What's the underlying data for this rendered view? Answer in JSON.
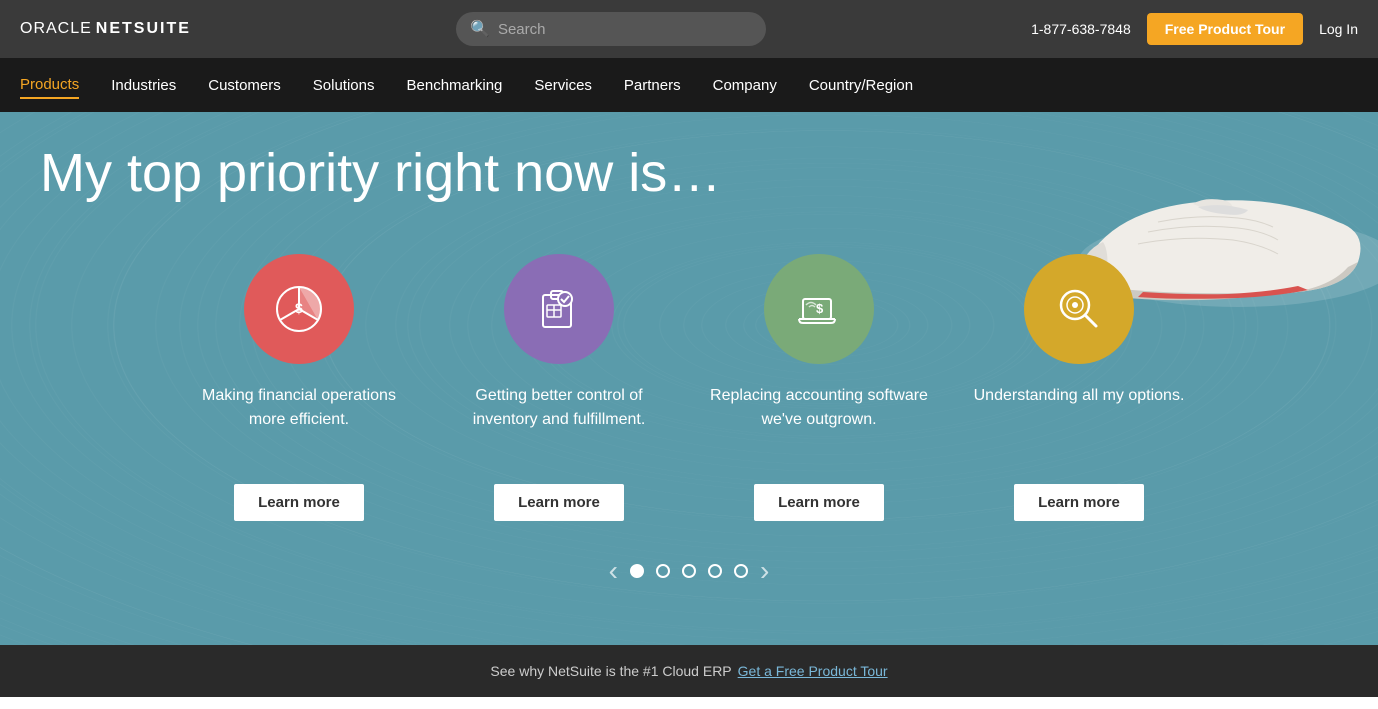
{
  "topbar": {
    "logo_oracle": "ORACLE",
    "logo_netsuite": "NETSUITE",
    "search_placeholder": "Search",
    "phone": "1-877-638-7848",
    "free_tour_btn": "Free Product Tour",
    "login_btn": "Log In"
  },
  "nav": {
    "items": [
      {
        "label": "Products",
        "active": true
      },
      {
        "label": "Industries",
        "active": false
      },
      {
        "label": "Customers",
        "active": false
      },
      {
        "label": "Solutions",
        "active": false
      },
      {
        "label": "Benchmarking",
        "active": false
      },
      {
        "label": "Services",
        "active": false
      },
      {
        "label": "Partners",
        "active": false
      },
      {
        "label": "Company",
        "active": false
      },
      {
        "label": "Country/Region",
        "active": false
      }
    ]
  },
  "hero": {
    "title": "My top priority right now is…",
    "cards": [
      {
        "id": "financial",
        "icon_color": "red",
        "text": "Making financial operations more efficient.",
        "btn_label": "Learn more"
      },
      {
        "id": "inventory",
        "icon_color": "purple",
        "text": "Getting better control of inventory and fulfillment.",
        "btn_label": "Learn more"
      },
      {
        "id": "accounting",
        "icon_color": "green",
        "text": "Replacing accounting software we've outgrown.",
        "btn_label": "Learn more"
      },
      {
        "id": "options",
        "icon_color": "yellow",
        "text": "Understanding all my options.",
        "btn_label": "Learn more"
      }
    ],
    "carousel_dots": 5,
    "active_dot": 0
  },
  "bottom_bar": {
    "text": "See why NetSuite is the #1 Cloud ERP",
    "link": "Get a Free Product Tour"
  }
}
